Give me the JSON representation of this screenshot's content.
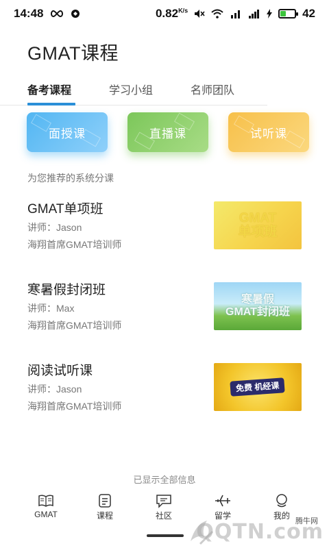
{
  "status_bar": {
    "time": "14:48",
    "speed": "0.82",
    "speed_unit": "K/s",
    "battery": "42",
    "battery_level": 0.42
  },
  "page": {
    "title": "GMAT课程"
  },
  "tabs": [
    {
      "label": "备考课程",
      "active": true
    },
    {
      "label": "学习小组",
      "active": false
    },
    {
      "label": "名师团队",
      "active": false
    }
  ],
  "categories": [
    {
      "label": "面授课",
      "color": "#52b6f2"
    },
    {
      "label": "直播课",
      "color": "#7cc75a"
    },
    {
      "label": "试听课",
      "color": "#f7c04a"
    }
  ],
  "section_label": "为您推荐的系统分课",
  "courses": [
    {
      "name": "GMAT单项班",
      "teacher": "讲师：Jason",
      "teacher_title": "海翔首席GMAT培训师",
      "thumb_line1": "GMAT",
      "thumb_line2": "单项班"
    },
    {
      "name": "寒暑假封闭班",
      "teacher": "讲师：Max",
      "teacher_title": "海翔首席GMAT培训师",
      "thumb_line1": "寒暑假",
      "thumb_line2": "GMAT封闭班"
    },
    {
      "name": "阅读试听课",
      "teacher": "讲师：Jason",
      "teacher_title": "海翔首席GMAT培训师",
      "thumb_line1": "免费 机经课",
      "thumb_line2": ""
    }
  ],
  "end_note": "已显示全部信息",
  "bottom_nav": [
    {
      "label": "GMAT",
      "icon": "book-icon"
    },
    {
      "label": "课程",
      "icon": "list-icon"
    },
    {
      "label": "社区",
      "icon": "chat-icon"
    },
    {
      "label": "留学",
      "icon": "plane-icon"
    },
    {
      "label": "我的",
      "icon": "profile-icon"
    }
  ],
  "watermark": {
    "small": "腾牛网",
    "main": "QQTN.com"
  },
  "colors": {
    "accent": "#2a8fd8",
    "blue": "#52b6f2",
    "green": "#7cc75a",
    "orange": "#f7c04a"
  }
}
